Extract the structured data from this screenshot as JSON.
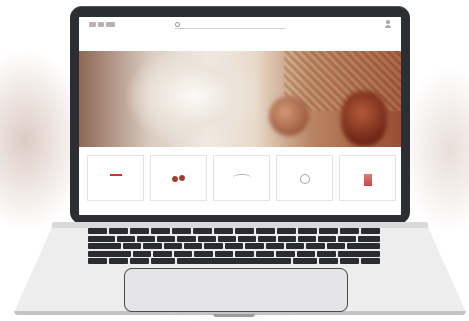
{
  "browser": {
    "search_placeholder": ""
  },
  "site": {
    "tagline": "",
    "hero_caption": "",
    "cards": [
      {
        "label": ""
      },
      {
        "label": ""
      },
      {
        "label": ""
      },
      {
        "label": ""
      },
      {
        "label": ""
      }
    ]
  },
  "colors": {
    "accent": "#c0392b",
    "tagline": "#c89b91",
    "laptop_body": "#2c2e34",
    "keyboard": "#2b2c30"
  },
  "icons": {
    "search": "search-icon",
    "user": "user-icon",
    "logo": "logo-icon"
  }
}
